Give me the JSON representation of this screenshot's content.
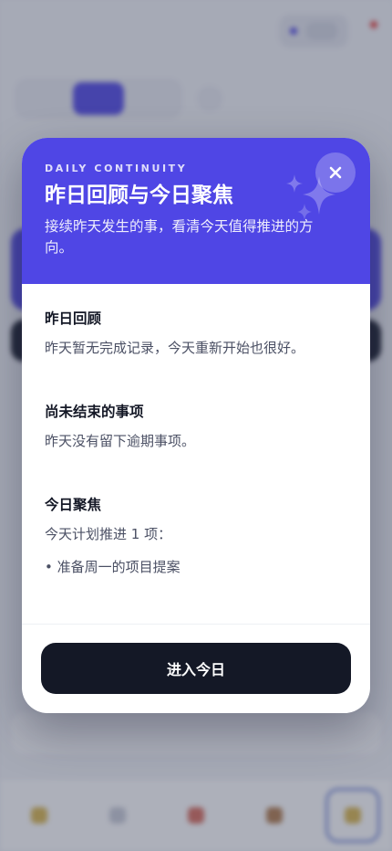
{
  "modal": {
    "eyebrow": "DAILY CONTINUITY",
    "title": "昨日回顾与今日聚焦",
    "subtitle": "接续昨天发生的事，看清今天值得推进的方向。",
    "close_label": "×",
    "sections": [
      {
        "title": "昨日回顾",
        "text": "昨天暂无完成记录，今天重新开始也很好。"
      },
      {
        "title": "尚未结束的事项",
        "text": "昨天没有留下逾期事项。"
      },
      {
        "title": "今日聚焦",
        "text": "今天计划推进 1 项：",
        "items": [
          "• 准备周一的项目提案"
        ]
      }
    ],
    "cta_label": "进入今日"
  },
  "colors": {
    "accent": "#4f46e5",
    "dark": "#141826",
    "overlay": "rgba(60,66,90,0.42)"
  },
  "icons": {
    "close": "close-icon",
    "sparkle": "sparkle-icon"
  }
}
